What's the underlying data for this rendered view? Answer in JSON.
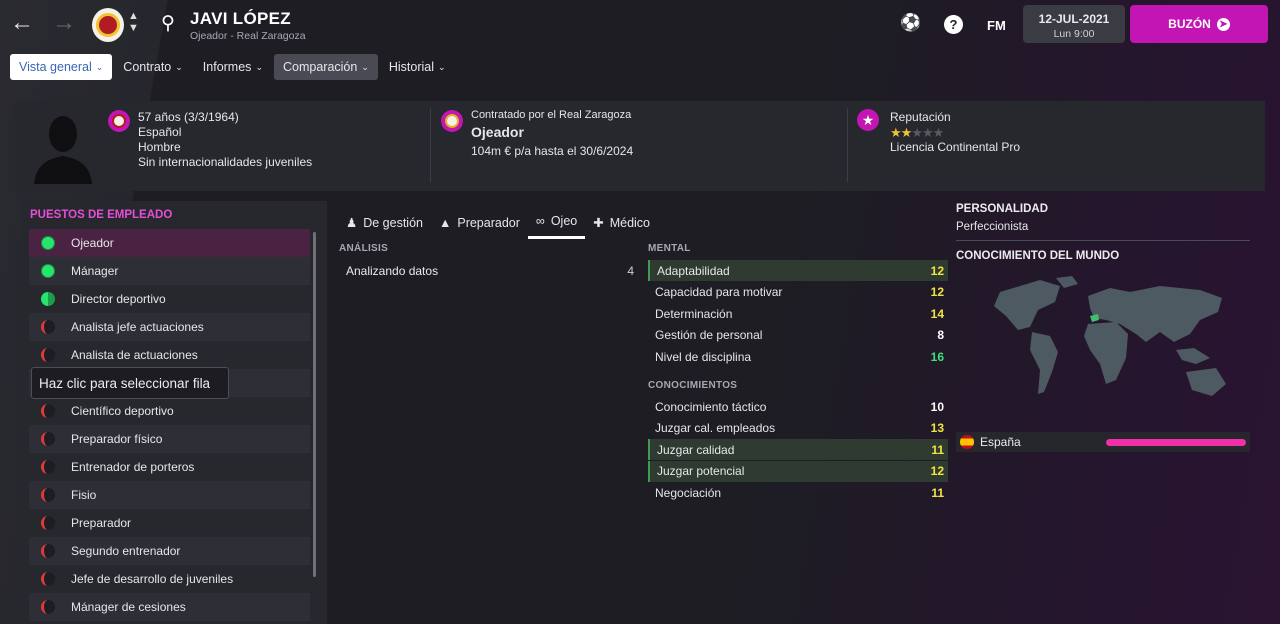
{
  "header": {
    "name": "JAVI LÓPEZ",
    "subtitle": "Ojeador - Real Zaragoza",
    "fm": "FM",
    "help": "?",
    "date": "12-JUL-2021",
    "time": "Lun 9:00",
    "inbox": "BUZÓN"
  },
  "menu": [
    "Vista general",
    "Contrato",
    "Informes",
    "Comparación",
    "Historial"
  ],
  "info": {
    "age": "57 años (3/3/1964)",
    "nationality": "Español",
    "gender": "Hombre",
    "youth": "Sin internacionalidades juveniles",
    "contract_label": "Contratado por el Real Zaragoza",
    "role": "Ojeador",
    "salary": "104m € p/a hasta el 30/6/2024",
    "rep_label": "Reputación",
    "rep_stars_filled": 2,
    "rep_stars_total": 5,
    "license": "Licencia Continental Pro"
  },
  "positions": {
    "title": "PUESTOS DE EMPLEADO",
    "items": [
      {
        "label": "Ojeador",
        "rating": "full"
      },
      {
        "label": "Mánager",
        "rating": "full"
      },
      {
        "label": "Director deportivo",
        "rating": "half"
      },
      {
        "label": "Analista jefe actuaciones",
        "rating": "low"
      },
      {
        "label": "Analista de actuaciones",
        "rating": "low"
      },
      {
        "label": "",
        "rating": "low"
      },
      {
        "label": "Científico deportivo",
        "rating": "low"
      },
      {
        "label": "Preparador físico",
        "rating": "low"
      },
      {
        "label": "Entrenador de porteros",
        "rating": "low"
      },
      {
        "label": "Fisio",
        "rating": "low"
      },
      {
        "label": "Preparador",
        "rating": "low"
      },
      {
        "label": "Segundo entrenador",
        "rating": "low"
      },
      {
        "label": "Jefe de desarrollo de juveniles",
        "rating": "low"
      },
      {
        "label": "Mánager de cesiones",
        "rating": "low"
      }
    ]
  },
  "tooltip": "Haz clic para seleccionar fila",
  "tabs": [
    "De gestión",
    "Preparador",
    "Ojeo",
    "Médico"
  ],
  "analysis": {
    "title": "ANÁLISIS",
    "label": "Analizando datos",
    "value": "4"
  },
  "mental": {
    "title": "MENTAL",
    "items": [
      {
        "name": "Adaptabilidad",
        "value": "12",
        "hl": true,
        "c": "y"
      },
      {
        "name": "Capacidad para motivar",
        "value": "12",
        "hl": false,
        "c": "y"
      },
      {
        "name": "Determinación",
        "value": "14",
        "hl": false,
        "c": "y"
      },
      {
        "name": "Gestión de personal",
        "value": "8",
        "hl": false,
        "c": "w"
      },
      {
        "name": "Nivel de disciplina",
        "value": "16",
        "hl": false,
        "c": "g"
      }
    ]
  },
  "knowledge": {
    "title": "CONOCIMIENTOS",
    "items": [
      {
        "name": "Conocimiento táctico",
        "value": "10",
        "hl": false,
        "c": "w"
      },
      {
        "name": "Juzgar cal. empleados",
        "value": "13",
        "hl": false,
        "c": "y"
      },
      {
        "name": "Juzgar calidad",
        "value": "11",
        "hl": true,
        "c": "y"
      },
      {
        "name": "Juzgar potencial",
        "value": "12",
        "hl": true,
        "c": "y"
      },
      {
        "name": "Negociación",
        "value": "11",
        "hl": false,
        "c": "y"
      }
    ]
  },
  "personality": {
    "title": "PERSONALIDAD",
    "value": "Perfeccionista"
  },
  "world": {
    "title": "CONOCIMIENTO DEL MUNDO",
    "country": "España",
    "level": 1.0
  }
}
